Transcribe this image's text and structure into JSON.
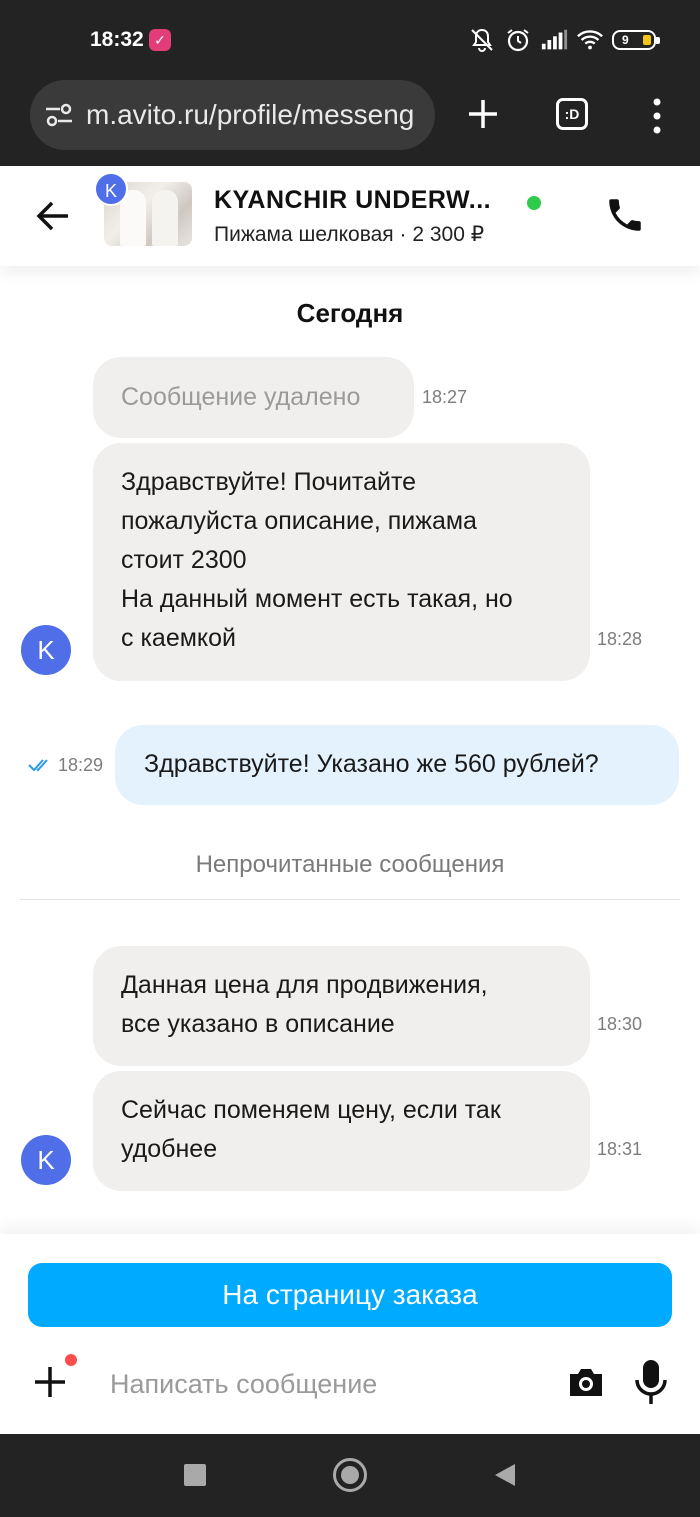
{
  "status_bar": {
    "time": "18:32",
    "battery_level": "9"
  },
  "browser": {
    "url": "m.avito.ru/profile/messeng",
    "tab_count_label": ":D"
  },
  "chat_header": {
    "seller_initial": "K",
    "seller_name": "KYANCHIR UNDERW...",
    "item_subtitle": "Пижама шелковая · 2 300 ₽",
    "online_color": "#2ecc4a"
  },
  "messages": {
    "day_label": "Сегодня",
    "unread_label": "Непрочитанные сообщения",
    "items": [
      {
        "direction": "in",
        "text": "Сообщение удалено",
        "time": "18:27",
        "deleted": true
      },
      {
        "direction": "in",
        "lines": [
          "Здравствуйте! Почитайте",
          "пожалуйста описание, пижама",
          "стоит 2300",
          "На данный момент есть такая, но",
          "с каемкой"
        ],
        "time": "18:28"
      },
      {
        "direction": "out",
        "text": "Здравствуйте! Указано же 560 рублей?",
        "time": "18:29",
        "read": true
      },
      {
        "direction": "in",
        "lines": [
          "Данная цена для продвижения,",
          "все указано в описание"
        ],
        "time": "18:30"
      },
      {
        "direction": "in",
        "lines": [
          "Сейчас поменяем цену, если так",
          "удобнее"
        ],
        "time": "18:31"
      }
    ],
    "avatar_initial": "K"
  },
  "composer": {
    "order_button": "На страницу заказа",
    "placeholder": "Написать сообщение"
  },
  "colors": {
    "accent": "#00aaff",
    "avatar": "#4f6ee8",
    "incoming_bubble": "#f0efed",
    "outgoing_bubble": "#e3f2fc"
  },
  "icons": [
    "site-settings-icon",
    "new-tab-icon",
    "tabs-icon",
    "menu-icon",
    "back-arrow-icon",
    "phone-icon",
    "double-check-icon",
    "plus-icon",
    "camera-icon",
    "microphone-icon"
  ]
}
